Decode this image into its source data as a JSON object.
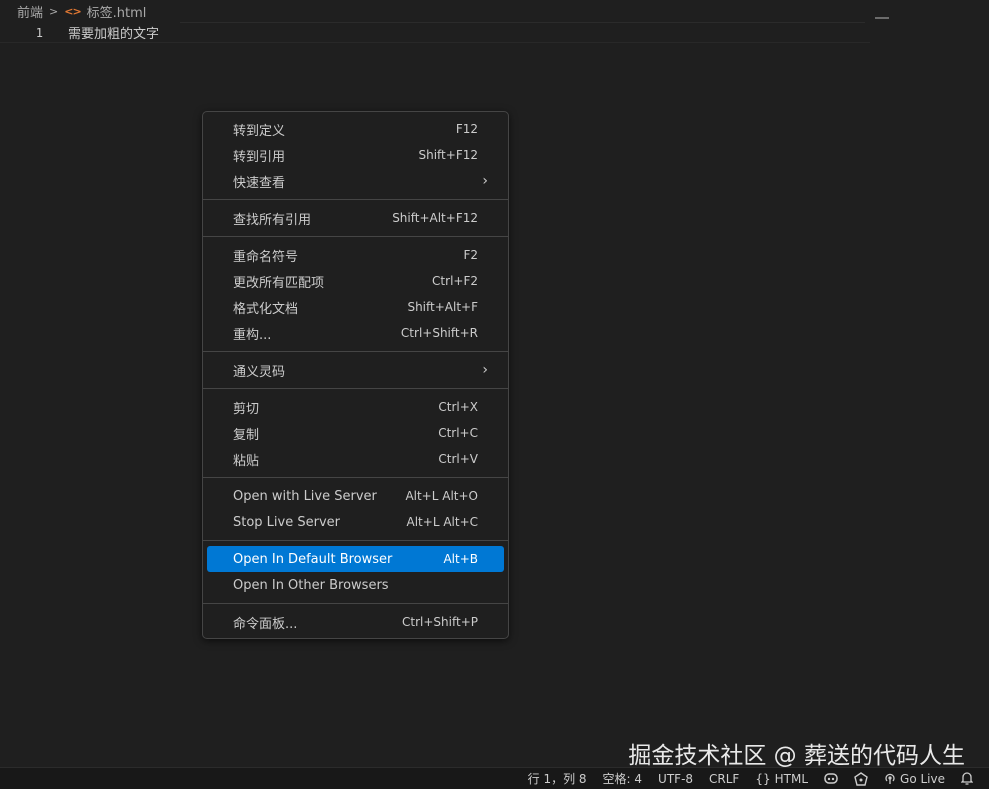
{
  "breadcrumb": {
    "folder": "前端",
    "file": "标签.html"
  },
  "editor": {
    "line_number": "1",
    "line_text": "需要加粗的文字"
  },
  "context_menu": {
    "groups": [
      [
        {
          "label": "转到定义",
          "shortcut": "F12"
        },
        {
          "label": "转到引用",
          "shortcut": "Shift+F12"
        },
        {
          "label": "快速查看",
          "submenu": true
        }
      ],
      [
        {
          "label": "查找所有引用",
          "shortcut": "Shift+Alt+F12"
        }
      ],
      [
        {
          "label": "重命名符号",
          "shortcut": "F2"
        },
        {
          "label": "更改所有匹配项",
          "shortcut": "Ctrl+F2"
        },
        {
          "label": "格式化文档",
          "shortcut": "Shift+Alt+F"
        },
        {
          "label": "重构...",
          "shortcut": "Ctrl+Shift+R"
        }
      ],
      [
        {
          "label": "通义灵码",
          "submenu": true
        }
      ],
      [
        {
          "label": "剪切",
          "shortcut": "Ctrl+X"
        },
        {
          "label": "复制",
          "shortcut": "Ctrl+C"
        },
        {
          "label": "粘贴",
          "shortcut": "Ctrl+V"
        }
      ],
      [
        {
          "label": "Open with Live Server",
          "shortcut": "Alt+L Alt+O"
        },
        {
          "label": "Stop Live Server",
          "shortcut": "Alt+L Alt+C"
        }
      ],
      [
        {
          "label": "Open In Default Browser",
          "shortcut": "Alt+B",
          "active": true
        },
        {
          "label": "Open In Other Browsers"
        }
      ],
      [
        {
          "label": "命令面板...",
          "shortcut": "Ctrl+Shift+P"
        }
      ]
    ],
    "active_color": "#0078d4"
  },
  "watermark": "掘金技术社区 @ 葬送的代码人生",
  "statusbar": {
    "position": "行 1，列 8",
    "indent": "空格: 4",
    "encoding": "UTF-8",
    "eol": "CRLF",
    "language": "HTML",
    "language_icon": "{}",
    "go_live": "Go Live"
  }
}
